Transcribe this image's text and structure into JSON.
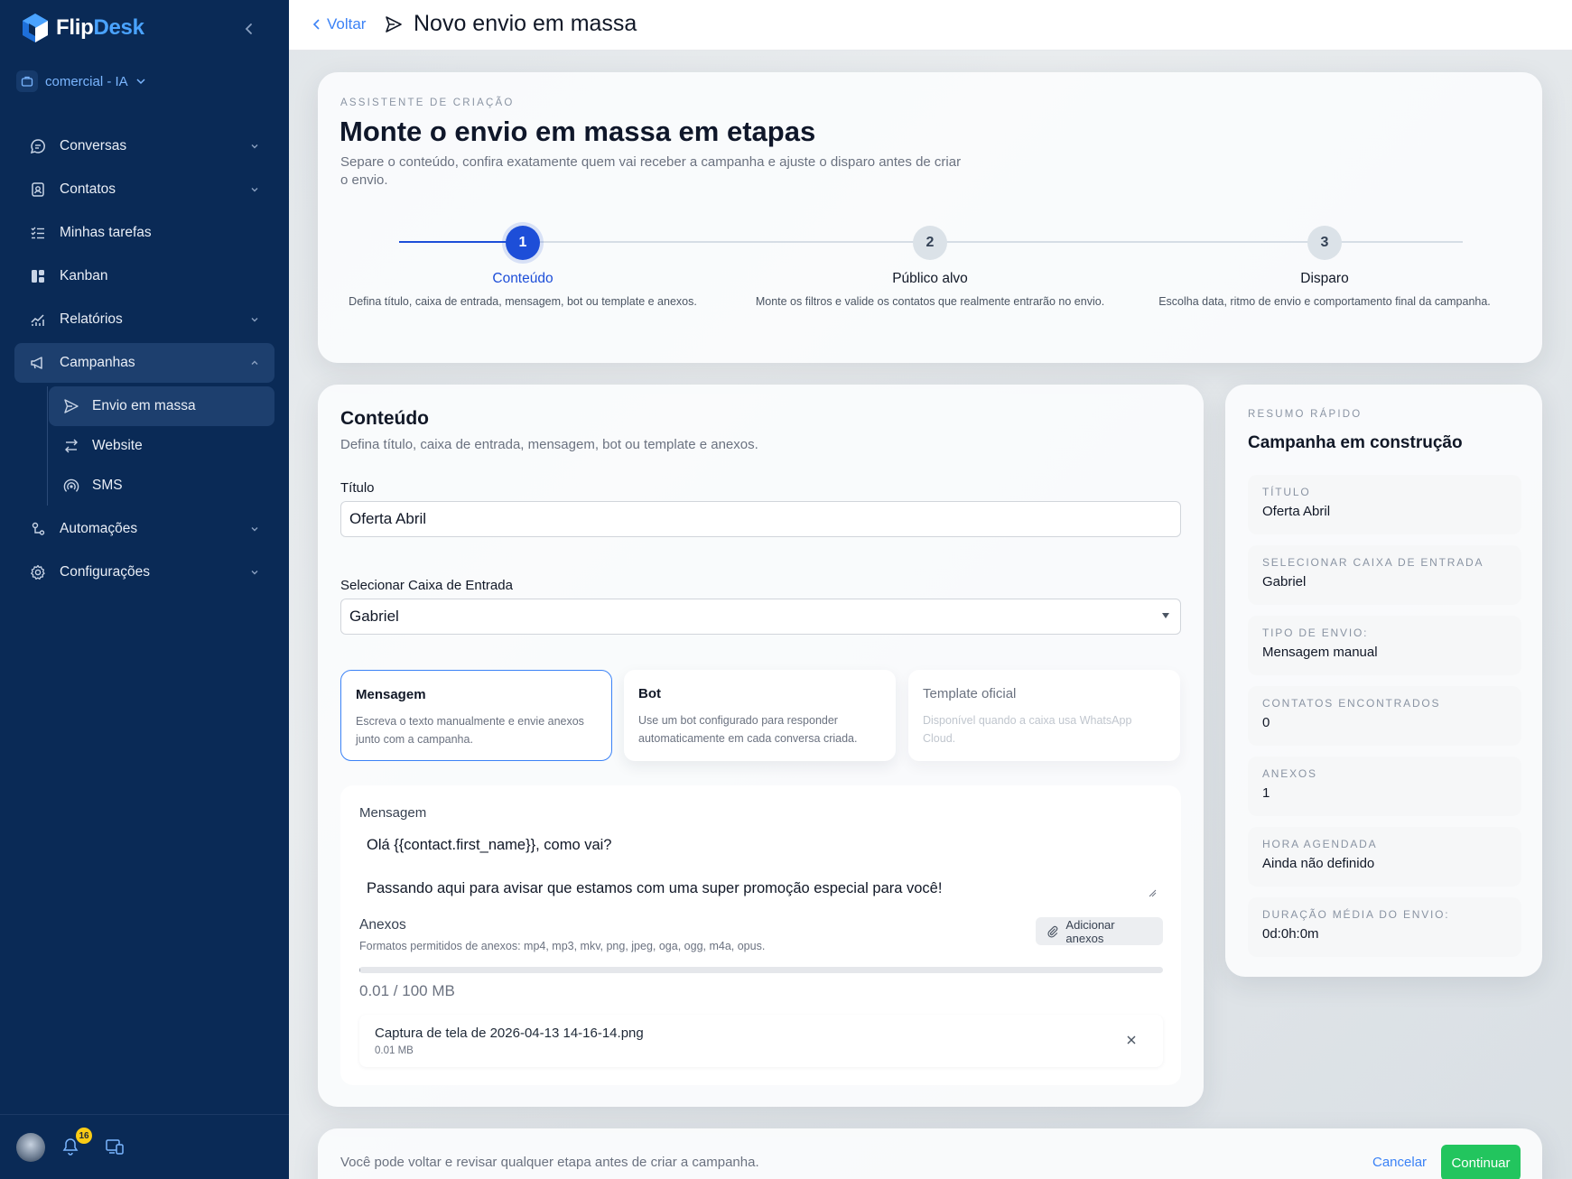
{
  "brand": {
    "name_part1": "Flip",
    "name_part2": "Desk"
  },
  "workspace": {
    "label": "comercial - IA"
  },
  "sidebar": {
    "items": [
      {
        "label": "Conversas",
        "icon": "chat-icon"
      },
      {
        "label": "Contatos",
        "icon": "contacts-icon"
      },
      {
        "label": "Minhas tarefas",
        "icon": "tasks-icon"
      },
      {
        "label": "Kanban",
        "icon": "kanban-icon"
      },
      {
        "label": "Relatórios",
        "icon": "reports-icon"
      },
      {
        "label": "Campanhas",
        "icon": "megaphone-icon"
      },
      {
        "label": "Automações",
        "icon": "automation-icon"
      },
      {
        "label": "Configurações",
        "icon": "gear-icon"
      }
    ],
    "subitems": [
      {
        "label": "Envio em massa",
        "icon": "send-icon"
      },
      {
        "label": "Website",
        "icon": "arrows-icon"
      },
      {
        "label": "SMS",
        "icon": "signal-icon"
      }
    ],
    "notifications_count": "16"
  },
  "topbar": {
    "back_label": "Voltar",
    "title": "Novo envio em massa"
  },
  "wizard": {
    "eyebrow": "ASSISTENTE DE CRIAÇÃO",
    "title": "Monte o envio em massa em etapas",
    "description": "Separe o conteúdo, confira exatamente quem vai receber a campanha e ajuste o disparo antes de criar o envio.",
    "steps": [
      {
        "number": "1",
        "label": "Conteúdo",
        "description": "Defina título, caixa de entrada, mensagem, bot ou template e anexos."
      },
      {
        "number": "2",
        "label": "Público alvo",
        "description": "Monte os filtros e valide os contatos que realmente entrarão no envio."
      },
      {
        "number": "3",
        "label": "Disparo",
        "description": "Escolha data, ritmo de envio e comportamento final da campanha."
      }
    ]
  },
  "content": {
    "title": "Conteúdo",
    "description": "Defina título, caixa de entrada, mensagem, bot ou template e anexos.",
    "title_label": "Título",
    "title_value": "Oferta Abril",
    "inbox_label": "Selecionar Caixa de Entrada",
    "inbox_value": "Gabriel",
    "options": [
      {
        "title": "Mensagem",
        "description": "Escreva o texto manualmente e envie anexos junto com a campanha."
      },
      {
        "title": "Bot",
        "description": "Use um bot configurado para responder automaticamente em cada conversa criada."
      },
      {
        "title": "Template oficial",
        "description": "Disponível quando a caixa usa WhatsApp Cloud."
      }
    ],
    "message_label": "Mensagem",
    "message_line1": "Olá {{contact.first_name}}, como vai?",
    "message_line2": "Passando aqui para avisar que estamos com uma super promoção especial para você!",
    "attachments_label": "Anexos",
    "attachments_formats": "Formatos permitidos de anexos: mp4, mp3, mkv, png, jpeg, oga, ogg, m4a, opus.",
    "add_attachments_label": "Adicionar anexos",
    "usage_text": "0.01 / 100 MB",
    "usage_fraction": 0.0001,
    "file": {
      "name": "Captura de tela de 2026-04-13 14-16-14.png",
      "size": "0.01 MB"
    }
  },
  "summary": {
    "eyebrow": "RESUMO RÁPIDO",
    "title": "Campanha em construção",
    "items": [
      {
        "key": "Título",
        "value": "Oferta Abril"
      },
      {
        "key": "Selecionar Caixa de Entrada",
        "value": "Gabriel"
      },
      {
        "key": "Tipo de envio:",
        "value": "Mensagem manual"
      },
      {
        "key": "Contatos encontrados",
        "value": "0"
      },
      {
        "key": "Anexos",
        "value": "1"
      },
      {
        "key": "Hora agendada",
        "value": "Ainda não definido"
      },
      {
        "key": "Duração média do envio:",
        "value": "0d:0h:0m"
      }
    ]
  },
  "footer": {
    "hint": "Você pode voltar e revisar qualquer etapa antes de criar a campanha.",
    "cancel_label": "Cancelar",
    "continue_label": "Continuar"
  },
  "colors": {
    "sidebar": "#0a2a56",
    "accent": "#1d4ed8",
    "continue": "#22c55e",
    "link": "#3b82f6"
  }
}
